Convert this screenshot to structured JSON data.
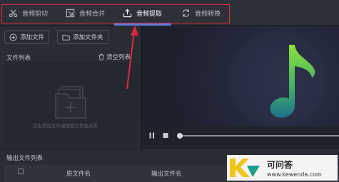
{
  "tabs": [
    {
      "label": "音频剪切",
      "icon": "scissors-icon"
    },
    {
      "label": "音频合并",
      "icon": "merge-icon"
    },
    {
      "label": "音频提取",
      "icon": "extract-icon",
      "active": true
    },
    {
      "label": "音频转换",
      "icon": "convert-icon"
    }
  ],
  "left": {
    "add_file": "添加文件",
    "add_folder": "添加文件夹",
    "list_title": "文件列表",
    "clear_list": "清空列表",
    "empty_hint": "点击添加文件或拖拽文件至此处"
  },
  "output": {
    "title": "输出文件列表",
    "columns": [
      "原文件名",
      "输出文件名"
    ]
  },
  "watermark": {
    "name": "可问答",
    "url": "www.kewenda.com"
  },
  "colors": {
    "highlight": "#e0283a",
    "accent": "#5b7bd6",
    "note_top": "#8fe03a",
    "note_bottom": "#1f6f8b"
  }
}
